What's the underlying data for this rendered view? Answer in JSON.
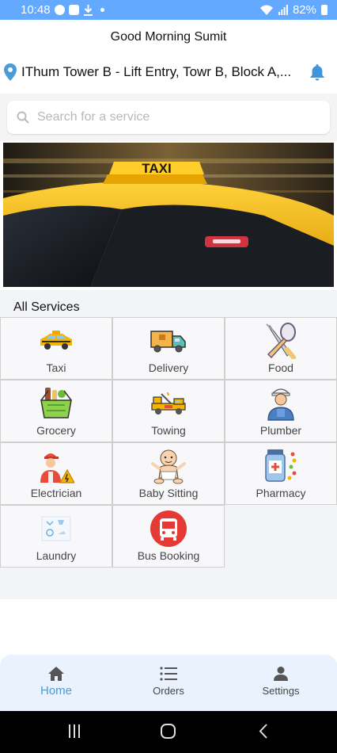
{
  "status_bar": {
    "time": "10:48",
    "battery": "82%",
    "icons": [
      "skype-icon",
      "gallery-icon",
      "download-icon",
      "dot-icon",
      "wifi-icon",
      "signal-icon",
      "battery-icon"
    ]
  },
  "header": {
    "greeting": "Good Morning Sumit",
    "location": "IThum Tower B - Lift Entry, Towr B, Block A,..."
  },
  "search": {
    "placeholder": "Search for a service"
  },
  "banner": {
    "sign_text": "TAXI"
  },
  "services": {
    "title": "All Services",
    "items": [
      {
        "label": "Taxi",
        "icon": "taxi-icon"
      },
      {
        "label": "Delivery",
        "icon": "delivery-truck-icon"
      },
      {
        "label": "Food",
        "icon": "food-icon"
      },
      {
        "label": "Grocery",
        "icon": "grocery-basket-icon"
      },
      {
        "label": "Towing",
        "icon": "tow-truck-icon"
      },
      {
        "label": "Plumber",
        "icon": "plumber-icon"
      },
      {
        "label": "Electrician",
        "icon": "electrician-icon"
      },
      {
        "label": "Baby Sitting",
        "icon": "baby-icon"
      },
      {
        "label": "Pharmacy",
        "icon": "pharmacy-icon"
      },
      {
        "label": "Laundry",
        "icon": "laundry-icon"
      },
      {
        "label": "Bus Booking",
        "icon": "bus-icon"
      }
    ]
  },
  "bottom_nav": {
    "items": [
      {
        "label": "Home",
        "icon": "home-icon",
        "active": true
      },
      {
        "label": "Orders",
        "icon": "list-icon",
        "active": false
      },
      {
        "label": "Settings",
        "icon": "person-icon",
        "active": false
      }
    ]
  },
  "system_nav": {
    "icons": [
      "recents-icon",
      "home-circle-icon",
      "back-icon"
    ]
  },
  "colors": {
    "status_bar": "#63a9ff",
    "accent": "#4a9bd8",
    "location_pin": "#4a9bd8",
    "bell": "#3f95dd",
    "bottom_nav_bg": "#eaf3fd",
    "taxi_yellow": "#f5b400"
  }
}
